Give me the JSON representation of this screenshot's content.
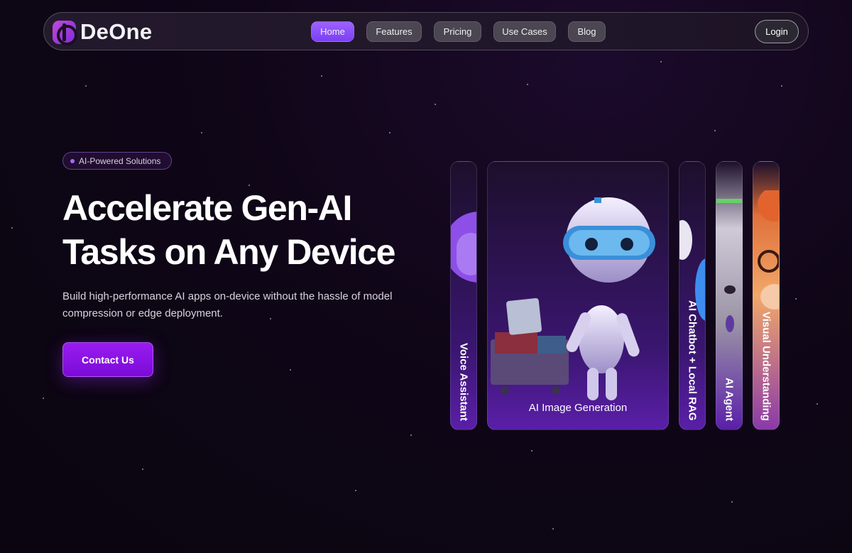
{
  "brand": {
    "name": "DeOne",
    "logo_icon": "deone-logo-icon"
  },
  "nav": {
    "items": [
      {
        "label": "Home",
        "active": true
      },
      {
        "label": "Features",
        "active": false
      },
      {
        "label": "Pricing",
        "active": false
      },
      {
        "label": "Use Cases",
        "active": false
      },
      {
        "label": "Blog",
        "active": false
      }
    ],
    "login_label": "Login"
  },
  "hero": {
    "badge": "AI-Powered Solutions",
    "headline_line1": "Accelerate Gen-AI",
    "headline_line2": "Tasks on Any Device",
    "subtext": "Build high-performance AI apps on-device without the hassle of model compression or edge deployment.",
    "cta_label": "Contact Us"
  },
  "cards": {
    "voice": "Voice Assistant",
    "image_gen": "AI Image Generation",
    "chatbot": "AI Chatbot + Local RAG",
    "agent": "AI Agent",
    "visual": "Visual Understanding"
  },
  "colors": {
    "accent": "#7b3ff2",
    "cta": "#8a12e6",
    "background": "#0f0617"
  }
}
